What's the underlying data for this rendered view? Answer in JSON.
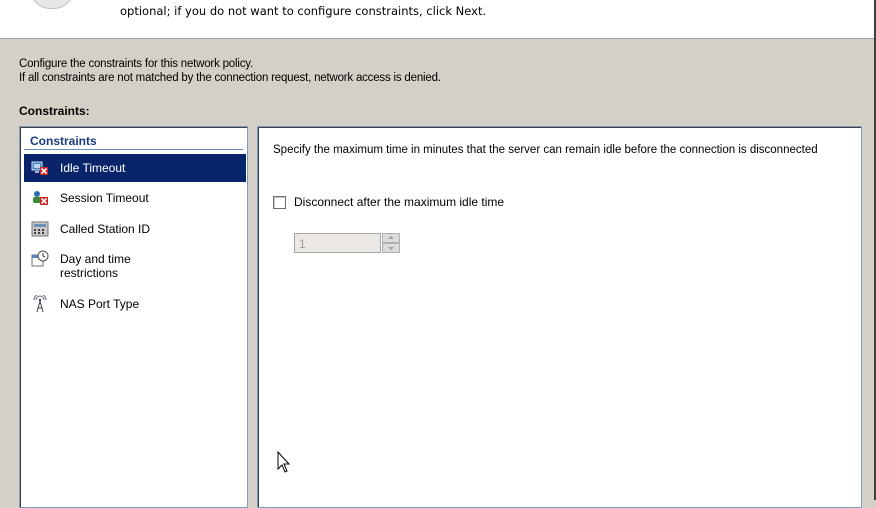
{
  "header": {
    "description": "optional; if you do not want to configure constraints, click Next."
  },
  "intro": {
    "line1": "Configure the constraints for this network policy.",
    "line2": "If all constraints are not matched by the connection request, network access is denied."
  },
  "section_label": "Constraints:",
  "constraints_list": {
    "title": "Constraints",
    "items": [
      {
        "label": "Idle Timeout",
        "icon": "idle-timeout-icon",
        "selected": true
      },
      {
        "label": "Session Timeout",
        "icon": "session-timeout-icon",
        "selected": false
      },
      {
        "label": "Called Station ID",
        "icon": "called-station-id-icon",
        "selected": false
      },
      {
        "label_line1": "Day and time",
        "label_line2": "restrictions",
        "icon": "calendar-clock-icon",
        "selected": false
      },
      {
        "label": "NAS Port Type",
        "icon": "antenna-icon",
        "selected": false
      }
    ]
  },
  "detail": {
    "description": "Specify the maximum time in minutes that the server can remain idle before the connection is disconnected",
    "checkbox_label": "Disconnect after the maximum idle time",
    "checkbox_checked": false,
    "spinner_value": "1",
    "spinner_disabled": true
  },
  "colors": {
    "selection_bg": "#0a246a",
    "list_title": "#1c3a80",
    "dialog_bg": "#d4d0c8"
  }
}
